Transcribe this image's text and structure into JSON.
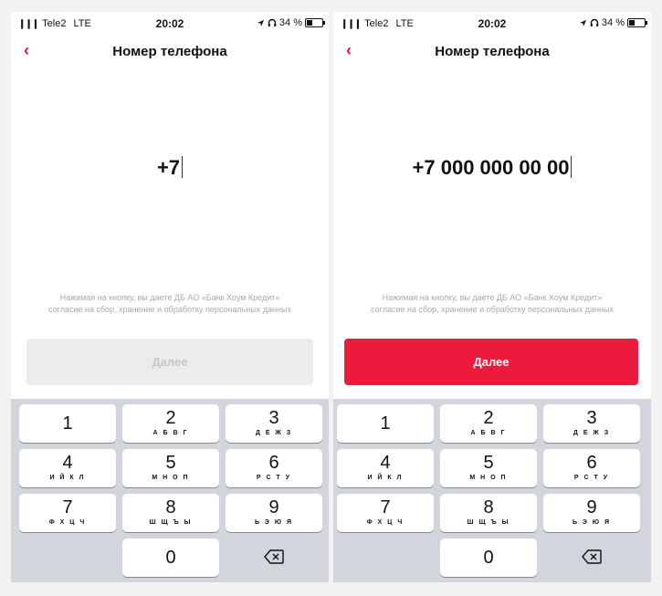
{
  "screens": [
    {
      "status": {
        "signal": "❙❙❙",
        "carrier": "Tele2",
        "network": "LTE",
        "time": "20:02",
        "battery": "34 %"
      },
      "nav": {
        "back": "‹",
        "title": "Номер телефона"
      },
      "phone_value": "+7",
      "disclaimer_line1": "Нажимая на кнопку, вы даете ДБ АО «Банк Хоум Кредит»",
      "disclaimer_line2": "согласие на сбор, хранение и обработку персональных данных",
      "cta": {
        "label": "Далее",
        "state": "disabled"
      }
    },
    {
      "status": {
        "signal": "❙❙❙",
        "carrier": "Tele2",
        "network": "LTE",
        "time": "20:02",
        "battery": "34 %"
      },
      "nav": {
        "back": "‹",
        "title": "Номер телефона"
      },
      "phone_value": "+7 000 000 00 00",
      "disclaimer_line1": "Нажимая на кнопку, вы даете ДБ АО «Банк Хоум Кредит»",
      "disclaimer_line2": "согласие на сбор, хранение и обработку персональных данных",
      "cta": {
        "label": "Далее",
        "state": "enabled"
      }
    }
  ],
  "keypad": [
    {
      "digit": "1",
      "letters": ""
    },
    {
      "digit": "2",
      "letters": "А Б В Г"
    },
    {
      "digit": "3",
      "letters": "Д Е Ж З"
    },
    {
      "digit": "4",
      "letters": "И Й К Л"
    },
    {
      "digit": "5",
      "letters": "М Н О П"
    },
    {
      "digit": "6",
      "letters": "Р С Т У"
    },
    {
      "digit": "7",
      "letters": "Ф Х Ц Ч"
    },
    {
      "digit": "8",
      "letters": "Ш Щ Ъ Ы"
    },
    {
      "digit": "9",
      "letters": "Ь Э Ю Я"
    },
    {
      "digit": "0",
      "letters": ""
    }
  ],
  "colors": {
    "accent": "#ec1a3d",
    "back_arrow": "#e0143c",
    "disabled_button": "#ececec",
    "keyboard_bg": "#d2d5db"
  },
  "icons": {
    "delete": "backspace-icon",
    "location": "location-arrow-icon",
    "headphones": "headphones-icon",
    "battery": "battery-icon",
    "signal": "signal-bars-icon"
  }
}
